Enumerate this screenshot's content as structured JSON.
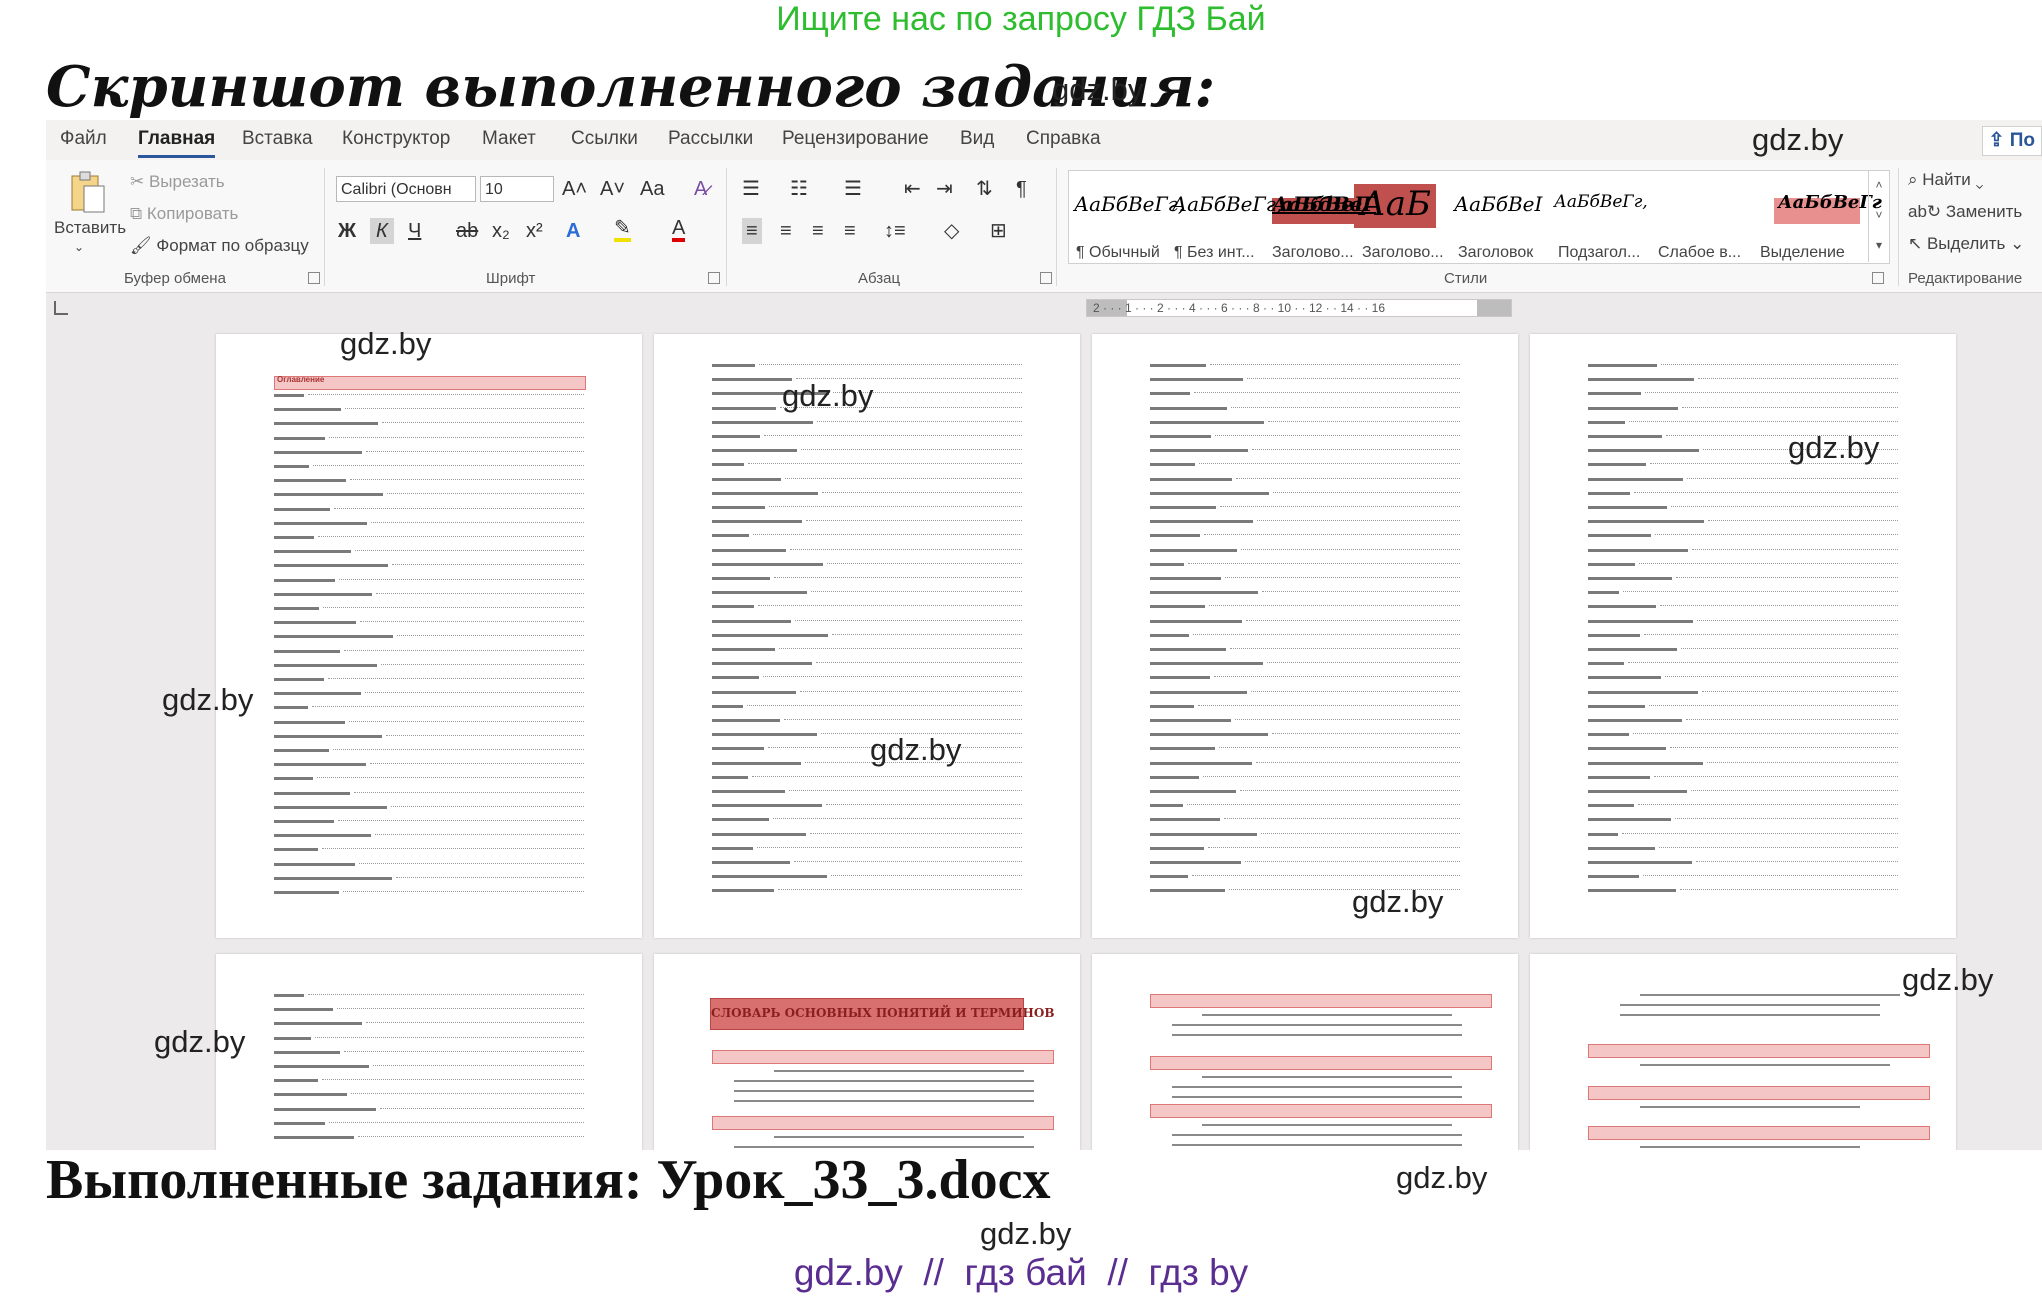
{
  "banner": "Ищите нас по запросу ГДЗ Бай",
  "heading": "Скриншот выполненного задания:",
  "footer_title": "Выполненные задания: Урок_33_3.docx",
  "footer_links": "gdz.by  //  гдз бай  //  гдз by",
  "watermark": "gdz.by",
  "word": {
    "tabs": [
      "Файл",
      "Главная",
      "Вставка",
      "Конструктор",
      "Макет",
      "Ссылки",
      "Рассылки",
      "Рецензирование",
      "Вид",
      "Справка"
    ],
    "share": "По",
    "clipboard": {
      "paste": "Вставить",
      "cut": "Вырезать",
      "copy": "Копировать",
      "format_painter": "Формат по образцу",
      "label": "Буфер обмена"
    },
    "font": {
      "name": "Calibri (Основн",
      "size": "10",
      "grow": "A˄",
      "shrink": "A˅",
      "case": "Aa",
      "bold": "Ж",
      "italic": "К",
      "underline": "Ч",
      "strike": "ab",
      "sub": "x₂",
      "sup": "x²",
      "label": "Шрифт"
    },
    "paragraph": {
      "label": "Абзац",
      "pilcrow": "¶"
    },
    "styles": {
      "items": [
        {
          "preview": "АаБбВеГг,",
          "name": "¶ Обычный",
          "color": "#333333"
        },
        {
          "preview": "АаБбВеГг,",
          "name": "¶ Без инт...",
          "color": "#333333"
        },
        {
          "preview": "АаБбВеГ",
          "name": "Заголово...",
          "color": "#b03030"
        },
        {
          "preview": "аБбВеГ",
          "name": "Заголово...",
          "color": "#ffffff"
        },
        {
          "preview": "АаБ",
          "name": "Заголовок",
          "color": "#ffffff"
        },
        {
          "preview": "АаБбВеI",
          "name": "Подзагол...",
          "color": "#b03030"
        },
        {
          "preview": "АаБбВеГг,",
          "name": "Слабое в...",
          "color": "#c06060"
        },
        {
          "preview": "АаБбВеГг",
          "name": "Выделение",
          "color": "#ffffff"
        }
      ],
      "label": "Стили"
    },
    "editing": {
      "find": "Найти",
      "replace": "Заменить",
      "select": "Выделить",
      "label": "Редактирование"
    },
    "ruler": "2 · · · 1 · · · 2 · · · 4 · · · 6 · · · 8 · · 10 · · 12 · · 14 · · 16",
    "section_heading": "СЛОВАРЬ ОСНОВНЫХ ПОНЯТИЙ И ТЕРМИНОВ",
    "toc_title": "Оглавление"
  }
}
